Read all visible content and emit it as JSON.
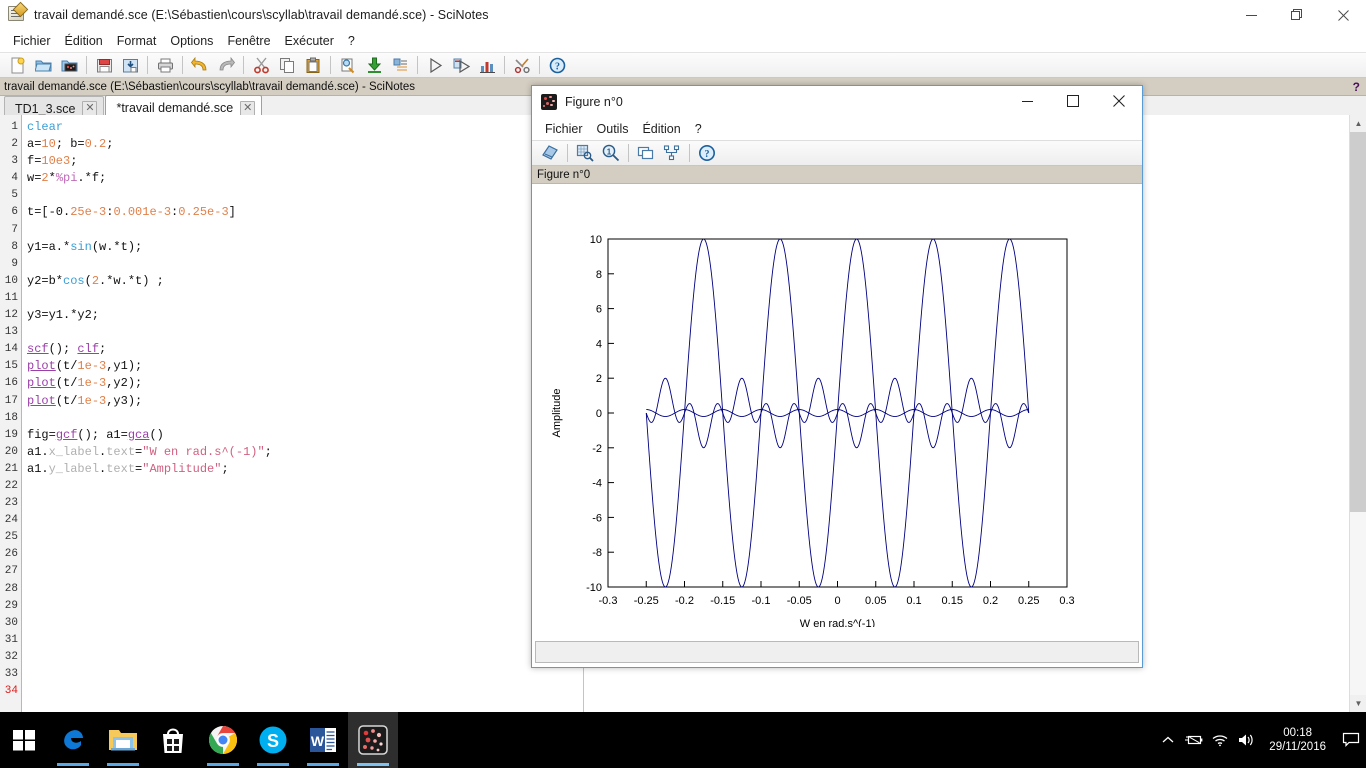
{
  "main_window": {
    "title": "travail demandé.sce (E:\\Sébastien\\cours\\scyllab\\travail demandé.sce) - SciNotes",
    "icon": "scinotes-icon",
    "controls": {
      "minimize": "minimize-icon",
      "maximize": "maximize-icon",
      "close": "close-icon"
    },
    "menu": [
      "Fichier",
      "Édition",
      "Format",
      "Options",
      "Fenêtre",
      "Exécuter",
      "?"
    ],
    "toolbar": [
      {
        "name": "new-file-icon",
        "title": "Nouveau"
      },
      {
        "name": "open-file-icon",
        "title": "Ouvrir"
      },
      {
        "name": "open-scilab-file-icon",
        "title": "Ouvrir un fichier dans Scilab"
      },
      {
        "name": "save-icon",
        "title": "Enregistrer"
      },
      {
        "name": "save-as-icon",
        "title": "Enregistrer sous"
      },
      {
        "name": "print-icon",
        "title": "Imprimer"
      },
      {
        "name": "undo-icon",
        "title": "Annuler"
      },
      {
        "name": "redo-icon",
        "title": "Rétablir"
      },
      {
        "name": "cut-icon",
        "title": "Couper"
      },
      {
        "name": "copy-icon",
        "title": "Copier"
      },
      {
        "name": "paste-icon",
        "title": "Coller"
      },
      {
        "name": "find-replace-icon",
        "title": "Rechercher / Remplacer"
      },
      {
        "name": "export-icon",
        "title": "Exporter"
      },
      {
        "name": "indent-icon",
        "title": "Indenter"
      },
      {
        "name": "execute-icon",
        "title": "Exécuter"
      },
      {
        "name": "execute-file-icon",
        "title": "Exécuter le fichier"
      },
      {
        "name": "profiling-icon",
        "title": "Profilage"
      },
      {
        "name": "preferences-icon",
        "title": "Préférences"
      },
      {
        "name": "help-icon",
        "title": "Aide"
      }
    ],
    "docbar": {
      "path": "travail demandé.sce (E:\\Sébastien\\cours\\scyllab\\travail demandé.sce) - SciNotes",
      "help_glyph": "?"
    },
    "tabs": [
      {
        "label": "TD1_3.sce",
        "active": false,
        "close": "✕"
      },
      {
        "label": "*travail demandé.sce",
        "active": true,
        "close": "✕"
      }
    ]
  },
  "editor": {
    "current_line": 34,
    "total_lines": 34,
    "lines": [
      {
        "n": 1,
        "text": "clear"
      },
      {
        "n": 2,
        "text": "a=10; b=0.2;"
      },
      {
        "n": 3,
        "text": "f=10e3;"
      },
      {
        "n": 4,
        "text": "w=2*%pi.*f;"
      },
      {
        "n": 5,
        "text": ""
      },
      {
        "n": 6,
        "text": "t=[-0.25e-3:0.001e-3:0.25e-3]"
      },
      {
        "n": 7,
        "text": ""
      },
      {
        "n": 8,
        "text": "y1=a.*sin(w.*t);"
      },
      {
        "n": 9,
        "text": ""
      },
      {
        "n": 10,
        "text": "y2=b*cos(2.*w.*t) ;"
      },
      {
        "n": 11,
        "text": ""
      },
      {
        "n": 12,
        "text": "y3=y1.*y2;"
      },
      {
        "n": 13,
        "text": ""
      },
      {
        "n": 14,
        "text": "scf(); clf;"
      },
      {
        "n": 15,
        "text": "plot(t/1e-3,y1);"
      },
      {
        "n": 16,
        "text": "plot(t/1e-3,y2);"
      },
      {
        "n": 17,
        "text": "plot(t/1e-3,y3);"
      },
      {
        "n": 18,
        "text": ""
      },
      {
        "n": 19,
        "text": "fig=gcf(); a1=gca()"
      },
      {
        "n": 20,
        "text": "a1.x_label.text=\"W en rad.s^(-1)\";"
      },
      {
        "n": 21,
        "text": "a1.y_label.text=\"Amplitude\";"
      },
      {
        "n": 22,
        "text": ""
      },
      {
        "n": 23,
        "text": ""
      },
      {
        "n": 24,
        "text": ""
      },
      {
        "n": 25,
        "text": ""
      },
      {
        "n": 26,
        "text": ""
      },
      {
        "n": 27,
        "text": ""
      },
      {
        "n": 28,
        "text": ""
      },
      {
        "n": 29,
        "text": ""
      },
      {
        "n": 30,
        "text": ""
      },
      {
        "n": 31,
        "text": ""
      },
      {
        "n": 32,
        "text": ""
      },
      {
        "n": 33,
        "text": ""
      },
      {
        "n": 34,
        "text": ""
      }
    ]
  },
  "figure_window": {
    "title": "Figure n°0",
    "icon": "scilab-figure-icon",
    "controls": {
      "minimize": "minimize-icon",
      "maximize": "maximize-icon",
      "close": "close-icon"
    },
    "menu": [
      "Fichier",
      "Outils",
      "Édition",
      "?"
    ],
    "toolbar": [
      {
        "name": "new-figure-icon",
        "title": "Nouvelle figure"
      },
      {
        "name": "zoom-area-icon",
        "title": "Zoom de zone"
      },
      {
        "name": "zoom-original-icon",
        "title": "Zoom d'origine"
      },
      {
        "name": "copy-figure-icon",
        "title": "Copier la figure"
      },
      {
        "name": "graphic-export-icon",
        "title": "Export graphique"
      },
      {
        "name": "help-icon",
        "title": "Aide"
      }
    ],
    "infobar_label": "Figure n°0",
    "status_text": ""
  },
  "chart_data": {
    "type": "line",
    "title": "",
    "xlabel": "W en rad.s^(-1)",
    "ylabel": "Amplitude",
    "xlim": [
      -0.3,
      0.3
    ],
    "ylim": [
      -10,
      10
    ],
    "xticks": [
      -0.3,
      -0.25,
      -0.2,
      -0.15,
      -0.1,
      -0.05,
      0,
      0.05,
      0.1,
      0.15,
      0.2,
      0.25,
      0.3
    ],
    "xticklabels": [
      "-0.3",
      "-0.25",
      "-0.2",
      "-0.15",
      "-0.1",
      "-0.05",
      "0",
      "0.05",
      "0.1",
      "0.15",
      "0.2",
      "0.25",
      "0.3"
    ],
    "yticks": [
      -10,
      -8,
      -6,
      -4,
      -2,
      0,
      2,
      4,
      6,
      8,
      10
    ],
    "yticklabels": [
      "-10",
      "-8",
      "-6",
      "-4",
      "-2",
      "0",
      "2",
      "4",
      "6",
      "8",
      "10"
    ],
    "grid": false,
    "legend": "none",
    "data_xrange": [
      -0.25,
      0.25
    ],
    "line_color": "#000080",
    "series": [
      {
        "name": "y1",
        "formula": "a*sin(w*t)",
        "amplitude": 10,
        "cycles_over_range": 5,
        "description": "Large sine wave, amplitude 10, 5 periods from -0.25 to 0.25 ms"
      },
      {
        "name": "y2",
        "formula": "b*cos(2*w*t)",
        "amplitude": 0.2,
        "cycles_over_range": 10,
        "description": "Small cosine wave, amplitude 0.2, 10 periods"
      },
      {
        "name": "y3",
        "formula": "y1.*y2",
        "amplitude": 2,
        "cycles_over_range": 10,
        "description": "Product wave, envelope amplitude 2"
      }
    ]
  },
  "taskbar": {
    "start": "windows-start-icon",
    "apps": [
      {
        "name": "edge-icon",
        "label": "Microsoft Edge",
        "open": true,
        "active": false
      },
      {
        "name": "file-explorer-icon",
        "label": "Explorateur de fichiers",
        "open": true,
        "active": false
      },
      {
        "name": "store-icon",
        "label": "Microsoft Store",
        "open": false,
        "active": false
      },
      {
        "name": "chrome-icon",
        "label": "Google Chrome",
        "open": true,
        "active": false
      },
      {
        "name": "skype-icon",
        "label": "Skype",
        "open": true,
        "active": false
      },
      {
        "name": "word-icon",
        "label": "Microsoft Word",
        "open": true,
        "active": false
      },
      {
        "name": "scilab-icon",
        "label": "Scilab",
        "open": true,
        "active": true
      }
    ],
    "tray": [
      {
        "name": "show-hidden-icons-chevron",
        "glyph": "⌃"
      },
      {
        "name": "battery-icon",
        "glyph": "battery"
      },
      {
        "name": "wifi-icon",
        "glyph": "wifi"
      },
      {
        "name": "volume-icon",
        "glyph": "volume"
      }
    ],
    "clock": {
      "time": "00:18",
      "date": "29/11/2016"
    },
    "action_center": "notification-icon"
  }
}
